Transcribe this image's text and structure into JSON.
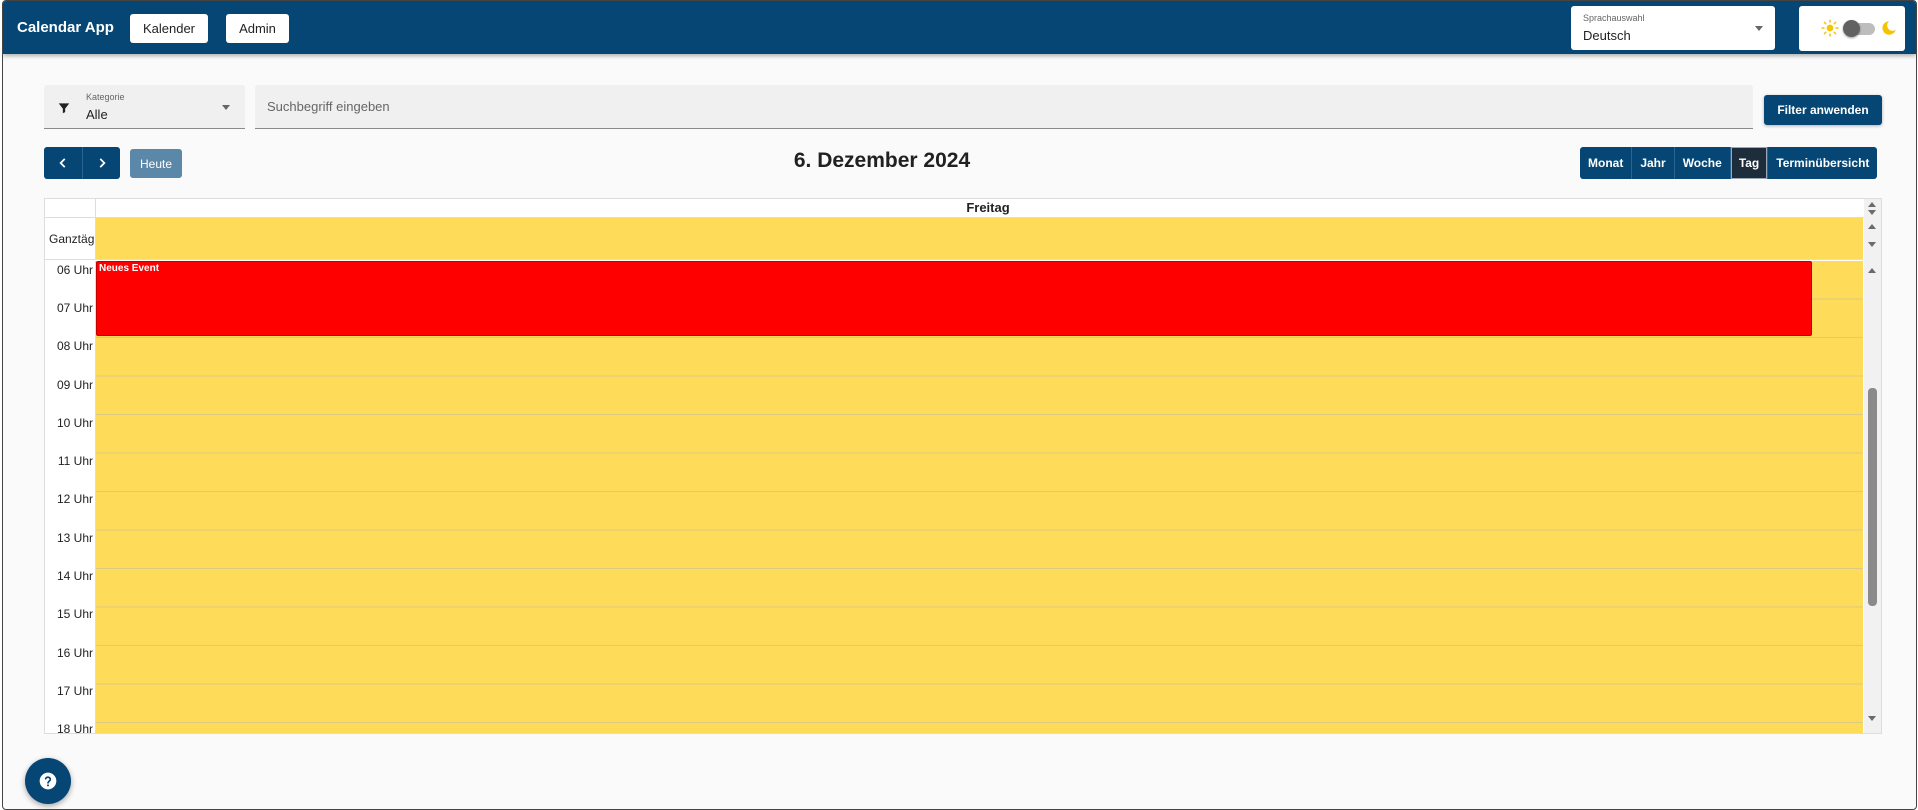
{
  "appbar": {
    "title": "Calendar App",
    "nav": [
      {
        "label": "Kalender"
      },
      {
        "label": "Admin"
      }
    ],
    "language": {
      "label": "Sprachauswahl",
      "value": "Deutsch"
    },
    "theme_toggle": {
      "state": "light"
    }
  },
  "filters": {
    "category_label": "Kategorie",
    "category_value": "Alle",
    "search_placeholder": "Suchbegriff eingeben",
    "apply_label": "Filter anwenden"
  },
  "toolbar": {
    "today_label": "Heute",
    "title": "6. Dezember 2024",
    "views": [
      "Monat",
      "Jahr",
      "Woche",
      "Tag",
      "Terminübersicht"
    ],
    "active_view": "Tag"
  },
  "calendar": {
    "day_header": "Freitag",
    "allday_label": "Ganztägig",
    "hours": [
      "06 Uhr",
      "07 Uhr",
      "08 Uhr",
      "09 Uhr",
      "10 Uhr",
      "11 Uhr",
      "12 Uhr",
      "13 Uhr",
      "14 Uhr",
      "15 Uhr",
      "16 Uhr",
      "17 Uhr",
      "18 Uhr"
    ],
    "events": [
      {
        "title": "Neues Event",
        "color": "#ff0000"
      }
    ],
    "cell_color": "#fedb58"
  },
  "colors": {
    "primary": "#054674",
    "today_button": "#5b87a8",
    "active_view": "#1e2d3b"
  },
  "help": {
    "icon": "help-icon"
  }
}
